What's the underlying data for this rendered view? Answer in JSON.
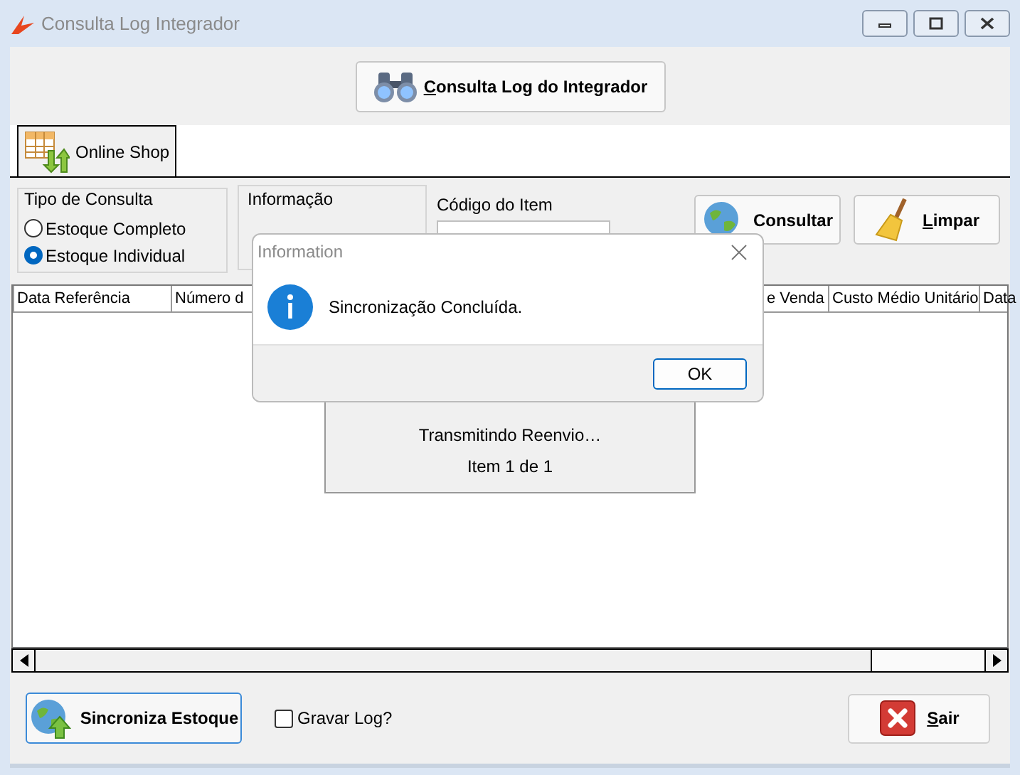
{
  "window": {
    "title": "Consulta Log Integrador"
  },
  "top_button": {
    "label": "Consulta Log do Integrador",
    "mnemonic": true
  },
  "tabs": [
    {
      "label": "Online Shop",
      "selected": true
    }
  ],
  "tipo_de_consulta": {
    "label": "Tipo de Consulta",
    "options": [
      {
        "label": "Estoque Completo",
        "selected": false
      },
      {
        "label": "Estoque Individual",
        "selected": true
      }
    ]
  },
  "informacao": {
    "label": "Informação"
  },
  "codigo_do_item": {
    "label": "Código do Item"
  },
  "action_buttons": [
    {
      "label": "Consultar",
      "mnemonic": false,
      "kind": "globe"
    },
    {
      "label": "Limpar",
      "mnemonic": true,
      "kind": "broom"
    }
  ],
  "table": {
    "columns": [
      "Data Referência",
      "Número d",
      "e Venda",
      "Custo Médio Unitário",
      "Data"
    ]
  },
  "bottom": {
    "sync_button": {
      "label": "Sincroniza Estoque"
    },
    "gravar_log": {
      "label": "Gravar Log?",
      "checked": false
    },
    "exit_button": {
      "label": "Sair",
      "mnemonic": true
    }
  },
  "progress": {
    "lines": [
      "Transmitindo Reenvio…",
      "Item 1 de 1"
    ]
  },
  "dialog": {
    "title": "Information",
    "message": "Sincronização Concluída.",
    "button": "OK"
  }
}
